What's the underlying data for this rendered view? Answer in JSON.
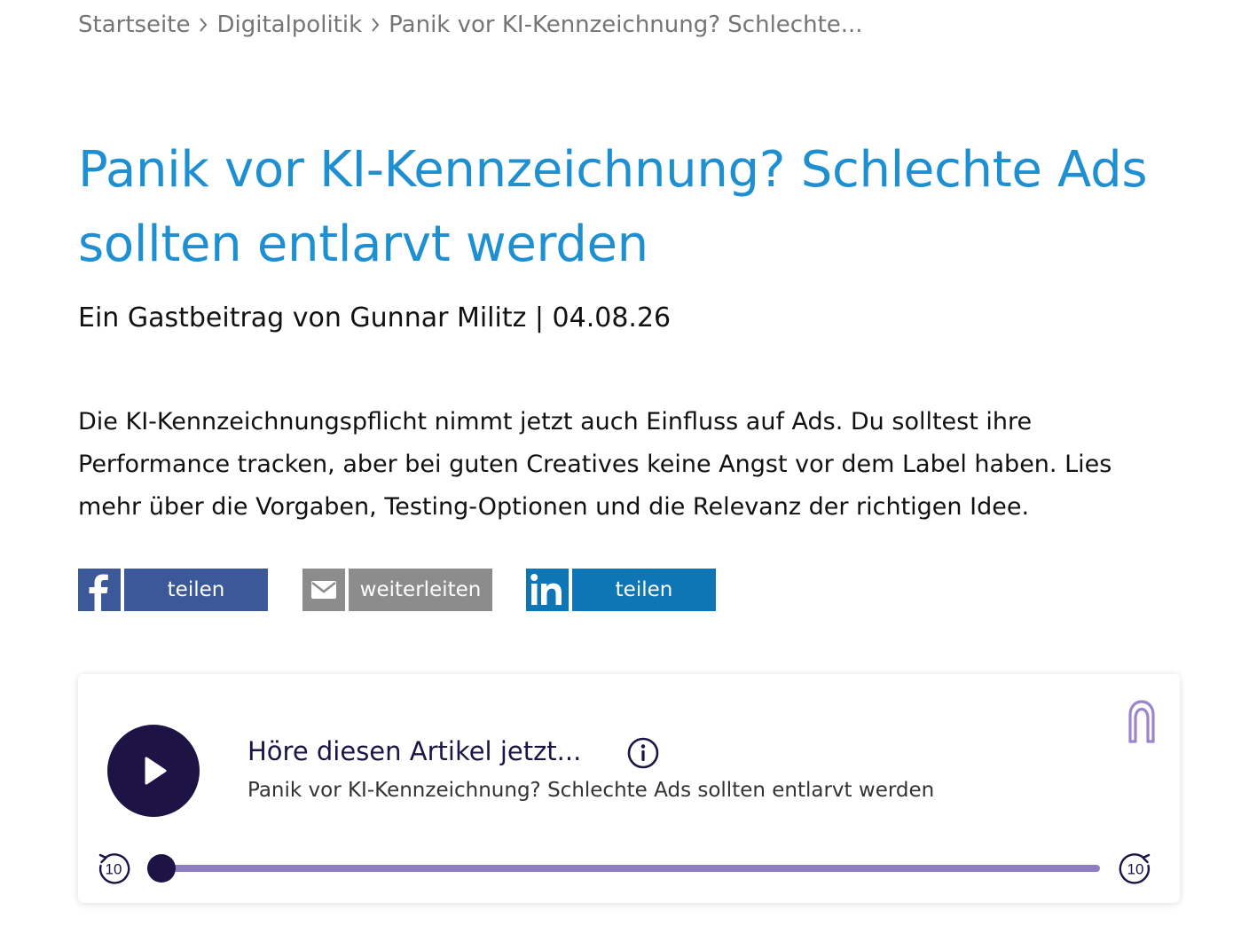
{
  "breadcrumb": {
    "items": [
      "Startseite",
      "Digitalpolitik",
      "Panik vor KI-Kennzeichnung? Schlechte..."
    ]
  },
  "article": {
    "title": "Panik vor KI-Kennzeichnung? Schlechte Ads sollten entlarvt werden",
    "byline": "Ein Gastbeitrag von Gunnar Militz | 04.08.26",
    "teaser": "Die KI-Kennzeichnungspflicht nimmt jetzt auch Einfluss auf Ads. Du solltest ihre Performance tracken, aber bei guten Creatives keine Angst vor dem Label haben. Lies mehr über die Vorgaben, Testing-Optionen und die Relevanz der richtigen Idee."
  },
  "share": {
    "facebook_label": "teilen",
    "email_label": "weiterleiten",
    "linkedin_label": "teilen",
    "icons": [
      "facebook-icon",
      "email-icon",
      "linkedin-icon"
    ]
  },
  "player": {
    "heading": "Höre diesen Artikel jetzt...",
    "subtitle": "Panik vor KI-Kennzeichnung? Schlechte Ads sollten entlarvt werden",
    "skip_back_label": "10",
    "skip_forward_label": "10",
    "progress": 0.0,
    "icons": [
      "play-icon",
      "info-icon",
      "brand-icon",
      "skip-back-icon",
      "skip-forward-icon"
    ]
  },
  "colors": {
    "title": "#1e8fd0",
    "facebook": "#3b5998",
    "email": "#8c8c8c",
    "linkedin": "#0e76b4",
    "player_dark": "#1d1345",
    "player_track": "#8f7dc2"
  }
}
